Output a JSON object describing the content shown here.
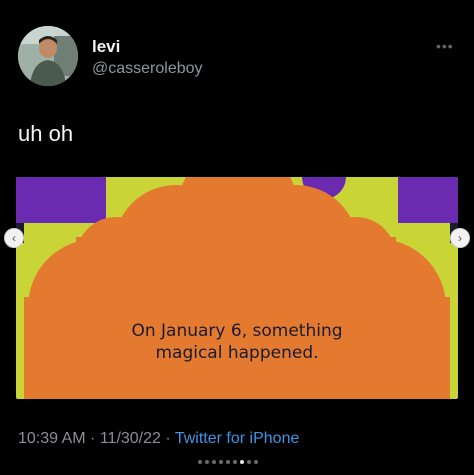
{
  "tweet": {
    "name": "levi",
    "handle": "@casseroleboy",
    "text": "uh oh",
    "more_icon": "more-dots-icon",
    "avatar_icon": "profile-photo-icon"
  },
  "media": {
    "caption_line1": "On January 6, something",
    "caption_line2": "magical happened.",
    "colors": {
      "orange": "#e37a30",
      "lime": "#c9d437",
      "purple": "#6a2bb0",
      "dark": "#1b1b2f"
    }
  },
  "meta": {
    "time": "10:39 AM",
    "separator1": " · ",
    "date": "11/30/22",
    "separator2": " · ",
    "source": "Twitter for iPhone"
  },
  "carousel": {
    "prev_icon": "chevron-left-icon",
    "next_icon": "chevron-right-icon",
    "active_index": 6,
    "count": 9
  }
}
